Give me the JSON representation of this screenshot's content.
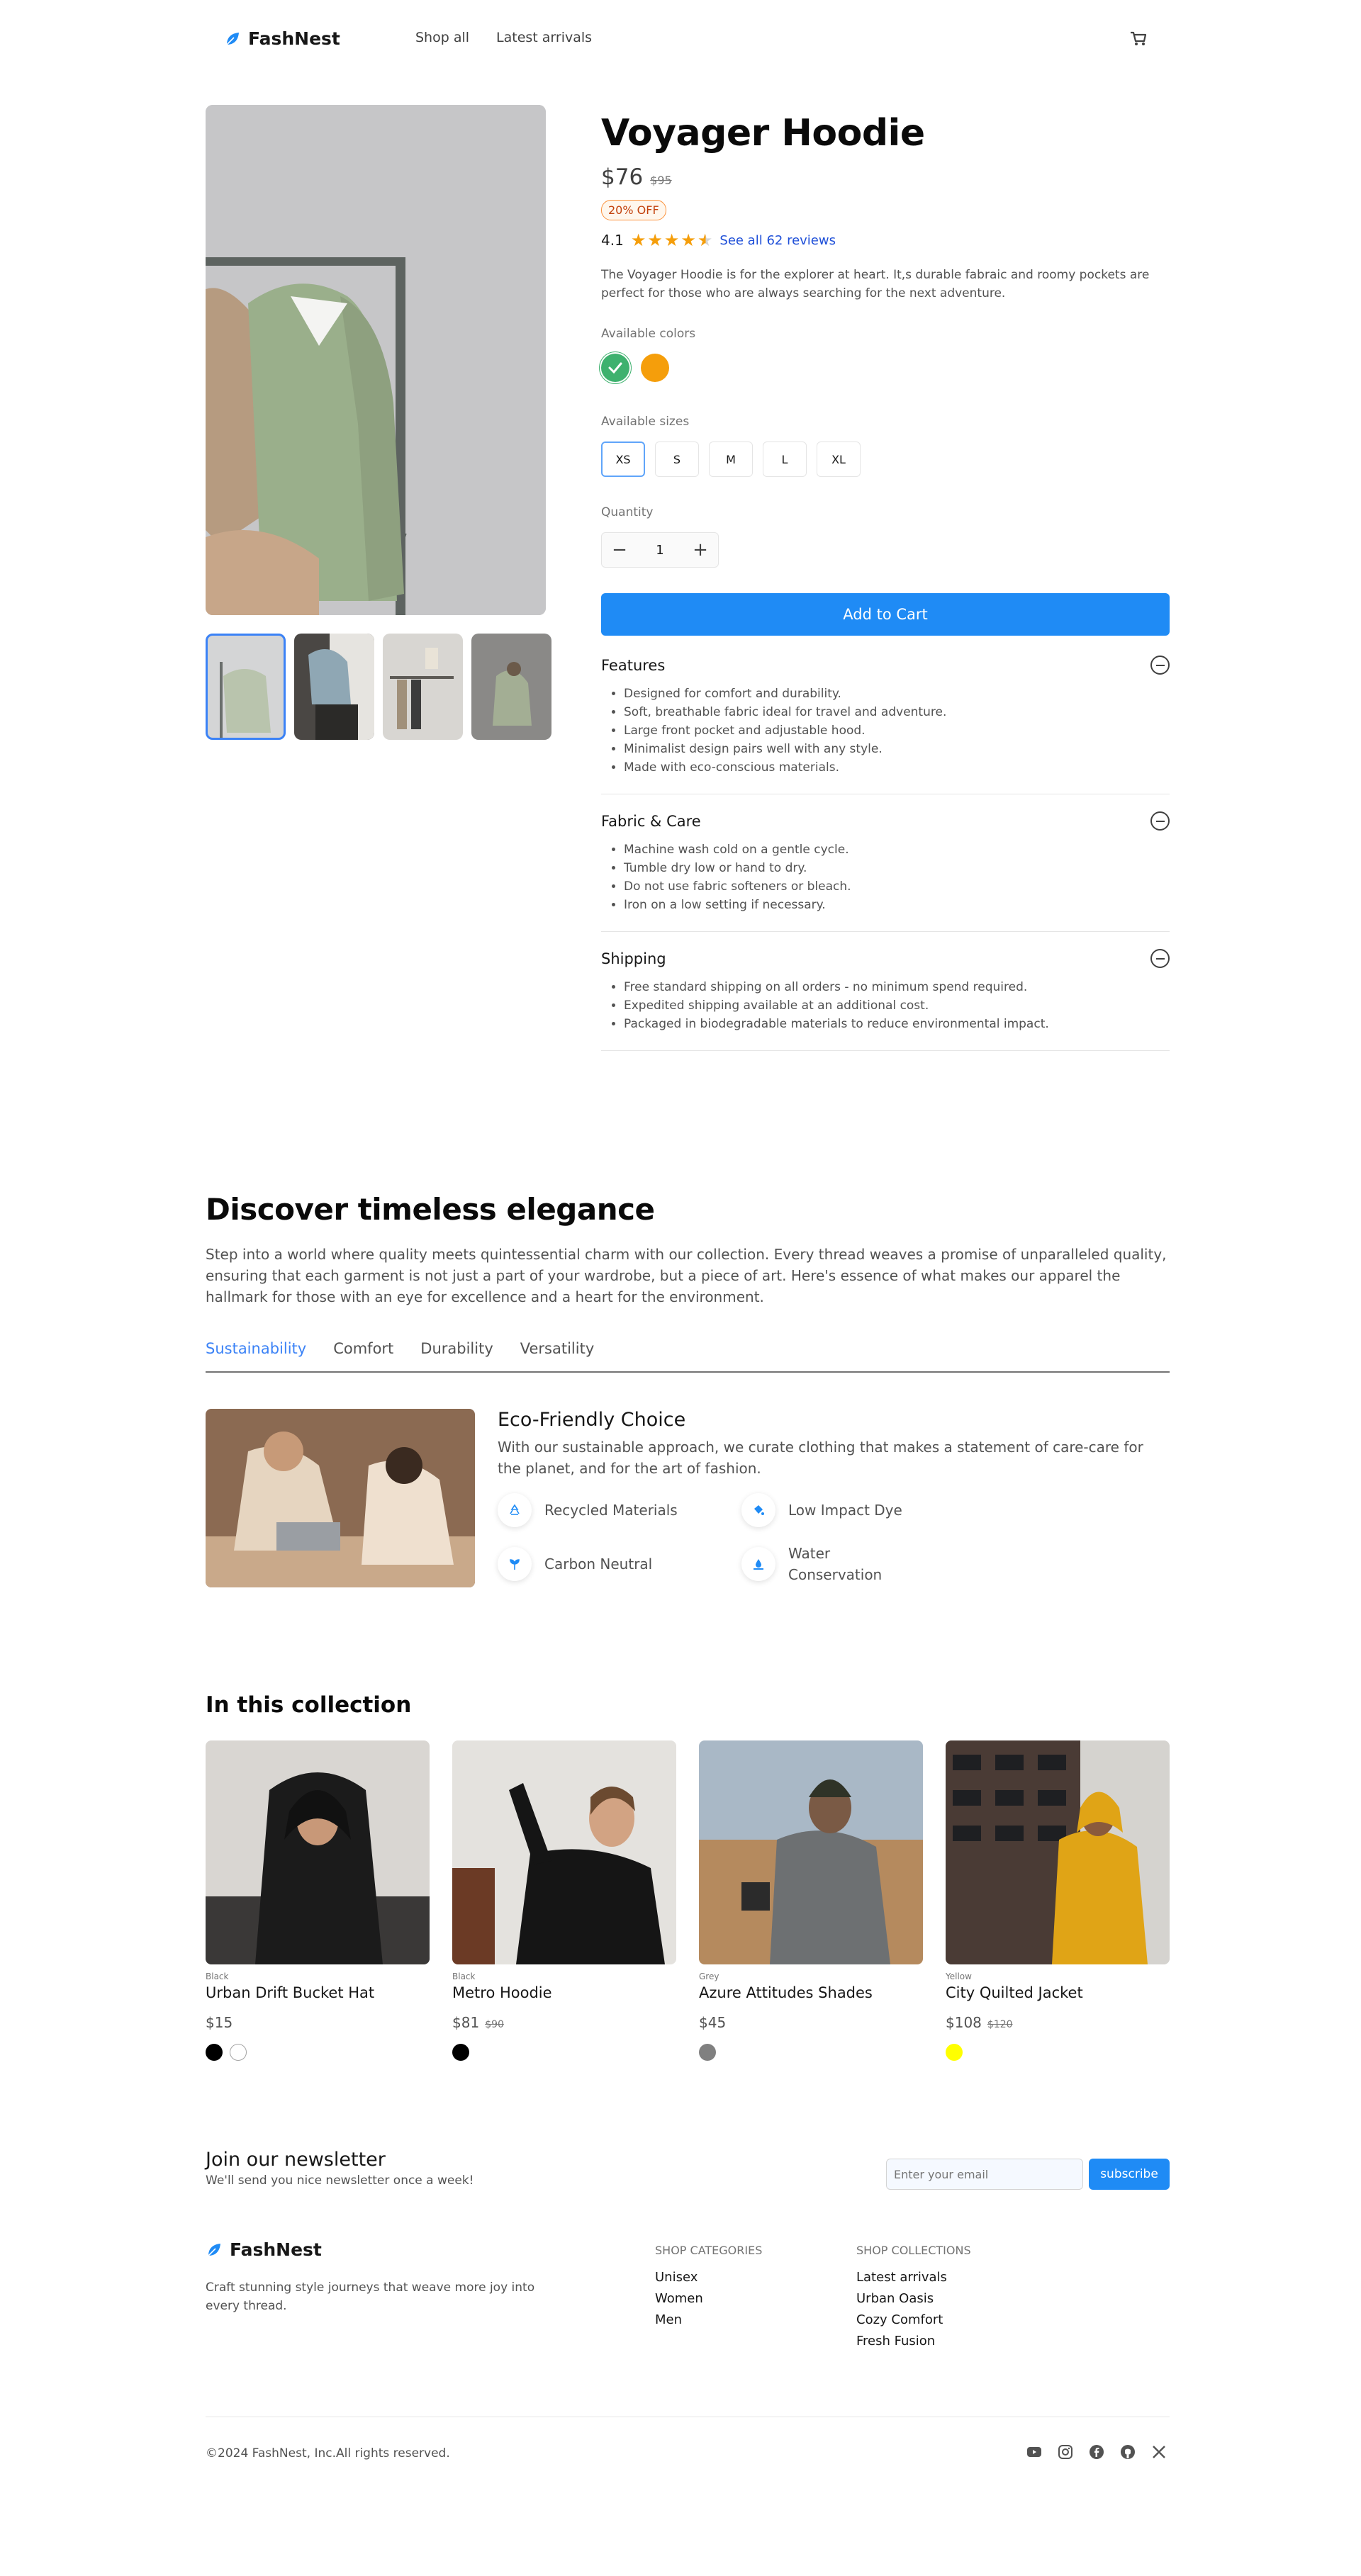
{
  "brand": {
    "name": "FashNest",
    "accent": "#1f8bf5"
  },
  "nav": {
    "links": [
      "Shop all",
      "Latest arrivals"
    ]
  },
  "product": {
    "title": "Voyager Hoodie",
    "price": "$76",
    "price_old": "$95",
    "badge": "20% OFF",
    "rating": "4.1",
    "stars_filled": 4.1,
    "reviews_link": "See all 62 reviews",
    "description": "The Voyager Hoodie is for the explorer at heart. It,s durable fabraic and roomy pockets are perfect for those who are always searching for the next adventure.",
    "colors_label": "Available colors",
    "colors": [
      "#3eb16e",
      "#f59e0b"
    ],
    "sizes_label": "Available sizes",
    "sizes": [
      "XS",
      "S",
      "M",
      "L",
      "XL"
    ],
    "selected_size": "XS",
    "quantity_label": "Quantity",
    "quantity": "1",
    "add_to_cart": "Add to Cart"
  },
  "accordion": [
    {
      "title": "Features",
      "items": [
        "Designed for comfort and durability.",
        "Soft, breathable fabric ideal for travel and adventure.",
        "Large front pocket and adjustable hood.",
        "Minimalist design pairs well with any style.",
        "Made with eco-conscious materials."
      ]
    },
    {
      "title": "Fabric & Care",
      "items": [
        "Machine wash cold on a gentle cycle.",
        "Tumble dry low or hand to dry.",
        "Do not use fabric softeners or bleach.",
        "Iron on a low setting if necessary."
      ]
    },
    {
      "title": "Shipping",
      "items": [
        "Free standard shipping on all orders - no minimum spend required.",
        "Expedited shipping available at an additional cost.",
        "Packaged in biodegradable materials to reduce environmental impact."
      ]
    }
  ],
  "discover": {
    "title": "Discover timeless elegance",
    "text": "Step into a world where quality meets quintessential charm with our collection. Every thread weaves a promise of unparalleled quality, ensuring that each garment is not just a part of your wardrobe, but a piece of art. Here's essence of what makes our apparel the hallmark for those with an eye for excellence and a heart for the environment.",
    "tabs": [
      "Sustainability",
      "Comfort",
      "Durability",
      "Versatility"
    ],
    "feature_title": "Eco-Friendly Choice",
    "feature_text": "With our sustainable approach, we curate clothing that makes a statement of care-care for the planet, and for the art of fashion.",
    "features": [
      "Recycled Materials",
      "Low Impact Dye",
      "Carbon Neutral",
      "Water Conservation"
    ]
  },
  "collection": {
    "title": "In this collection",
    "products": [
      {
        "color": "Black",
        "name": "Urban Drift Bucket Hat",
        "price": "$15",
        "price_old": "",
        "swatches": [
          "#000000",
          "#ffffff"
        ]
      },
      {
        "color": "Black",
        "name": "Metro Hoodie",
        "price": "$81",
        "price_old": "$90",
        "swatches": [
          "#000000"
        ]
      },
      {
        "color": "Grey",
        "name": "Azure Attitudes Shades",
        "price": "$45",
        "price_old": "",
        "swatches": [
          "#808080"
        ]
      },
      {
        "color": "Yellow",
        "name": "City Quilted Jacket",
        "price": "$108",
        "price_old": "$120",
        "swatches": [
          "#ffff00"
        ]
      }
    ]
  },
  "newsletter": {
    "title": "Join our newsletter",
    "subtitle": "We'll send you nice newsletter once a week!",
    "placeholder": "Enter your email",
    "button": "subscribe"
  },
  "footer": {
    "tagline": "Craft stunning style journeys that weave more joy into every thread.",
    "categories_title": "SHOP CATEGORIES",
    "categories": [
      "Unisex",
      "Women",
      "Men"
    ],
    "collections_title": "SHOP COLLECTIONS",
    "collections": [
      "Latest arrivals",
      "Urban Oasis",
      "Cozy Comfort",
      "Fresh Fusion"
    ],
    "copyright": "©2024 FashNest, Inc.All rights reserved.",
    "socials": [
      "youtube-icon",
      "instagram-icon",
      "facebook-icon",
      "github-icon",
      "x-icon"
    ]
  }
}
